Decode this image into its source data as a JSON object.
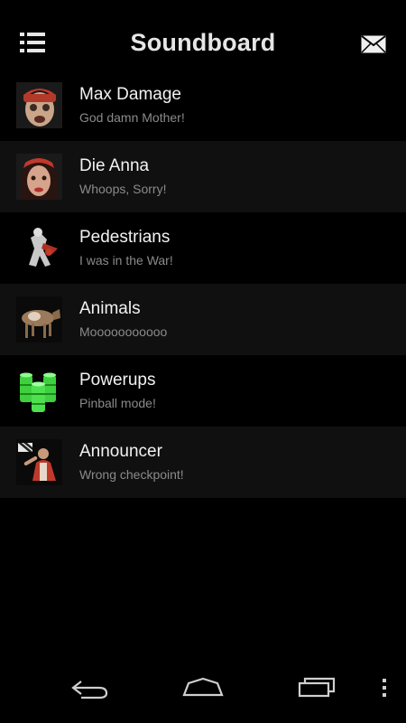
{
  "app": {
    "title": "Soundboard",
    "menu_icon": "menu-list-icon",
    "mail_icon": "mail-envelope-icon"
  },
  "items": [
    {
      "title": "Max Damage",
      "subtitle": "God damn Mother!",
      "icon": "max-damage-avatar"
    },
    {
      "title": "Die Anna",
      "subtitle": "Whoops, Sorry!",
      "icon": "die-anna-avatar"
    },
    {
      "title": "Pedestrians",
      "subtitle": "I was in the War!",
      "icon": "pedestrian-thumbnail"
    },
    {
      "title": "Animals",
      "subtitle": "Mooooooooooo",
      "icon": "cow-thumbnail"
    },
    {
      "title": "Powerups",
      "subtitle": "Pinball mode!",
      "icon": "barrels-thumbnail"
    },
    {
      "title": "Announcer",
      "subtitle": "Wrong checkpoint!",
      "icon": "announcer-thumbnail"
    }
  ],
  "navbar": {
    "back": "back-icon",
    "home": "home-icon",
    "recents": "recent-apps-icon",
    "overflow": "overflow-menu-icon"
  },
  "colors": {
    "background": "#000000",
    "row_alt": "#101010",
    "title_text": "#f2f2f2",
    "subtitle_text": "#8a8a8a"
  }
}
